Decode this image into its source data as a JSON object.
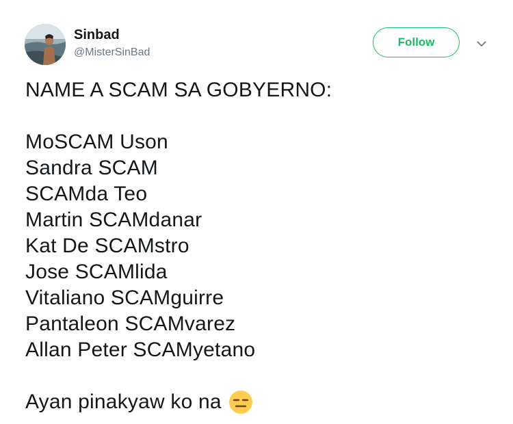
{
  "user": {
    "name": "Sinbad",
    "handle": "@MisterSinBad"
  },
  "actions": {
    "follow_label": "Follow",
    "menu_icon": "chevron-down-icon"
  },
  "tweet": {
    "heading": "NAME A SCAM SA GOBYERNO:",
    "list": [
      "MoSCAM Uson",
      "Sandra SCAM",
      "SCAMda Teo",
      "Martin SCAMdanar",
      "Kat De SCAMstro",
      "Jose SCAMlida",
      "Vitaliano SCAMguirre",
      "Pantaleon SCAMvarez",
      "Allan Peter SCAMyetano"
    ],
    "closing": "Ayan pinakyaw ko na",
    "closing_emoji": "expressionless-face-emoji"
  },
  "colors": {
    "follow_accent": "#17bf63",
    "handle_gray": "#657786",
    "text": "#14171a",
    "emoji_yellow": "#ffcc4d"
  }
}
